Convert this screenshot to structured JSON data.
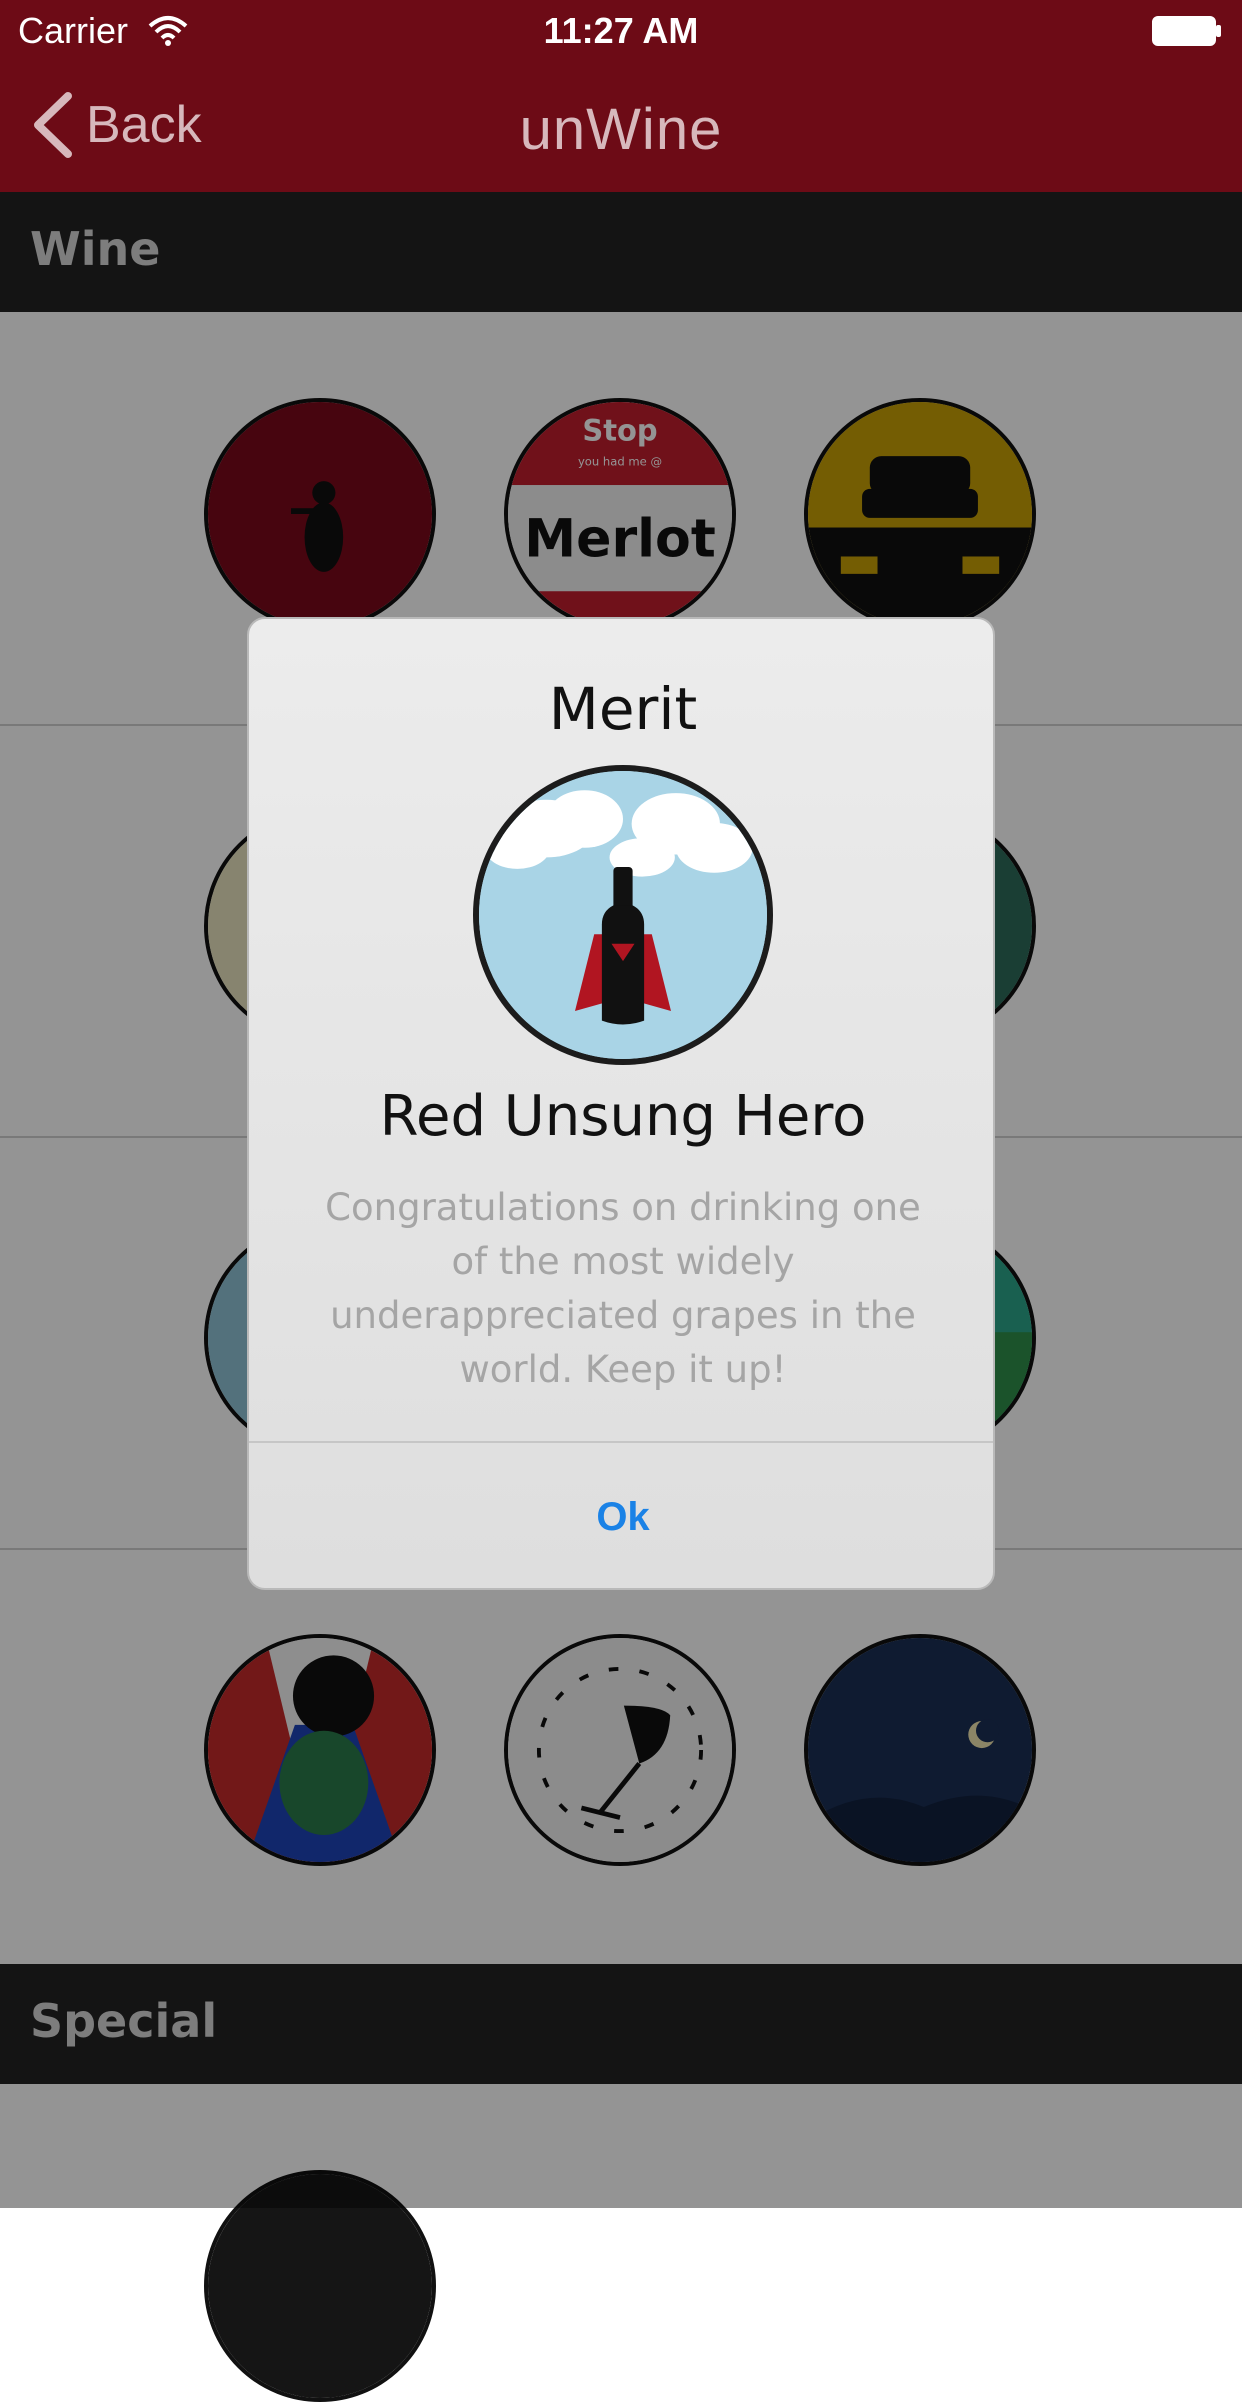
{
  "status_bar": {
    "carrier": "Carrier",
    "time": "11:27 AM",
    "wifi_icon": "wifi-icon",
    "battery_icon": "battery-icon"
  },
  "nav": {
    "back_label": "Back",
    "back_icon": "chevron-left-icon",
    "logo_text": "unWine"
  },
  "sections": [
    {
      "title": "Wine",
      "badges": [
        "waiter-badge-icon",
        "stop-merlot-badge-icon",
        "taxi-badge-icon",
        "vineyard-badge-icon",
        "clouds-badge-icon",
        "wine-hero-badge-icon",
        "sky-badge-icon",
        "field-badge-icon",
        "globe-badge-icon",
        "turkey-badge-icon",
        "clock-glass-badge-icon",
        "night-moon-badge-icon"
      ],
      "stop_merlot": {
        "stop": "Stop",
        "subtitle": "you had me @",
        "grape": "Merlot"
      }
    },
    {
      "title": "Special",
      "badges": [
        "special-badge-icon"
      ]
    }
  ],
  "alert": {
    "title": "Merit",
    "badge_icon": "red-unsung-hero-badge-icon",
    "badge_name": "Red Unsung Hero",
    "message": "Congratulations on drinking one of the most widely underappreciated grapes in the world.  Keep it up!",
    "ok_label": "Ok"
  },
  "colors": {
    "nav_background": "#6d0b16",
    "section_header": "#242424",
    "alert_button": "#1a82e6",
    "message_text": "#a5a5a5"
  }
}
